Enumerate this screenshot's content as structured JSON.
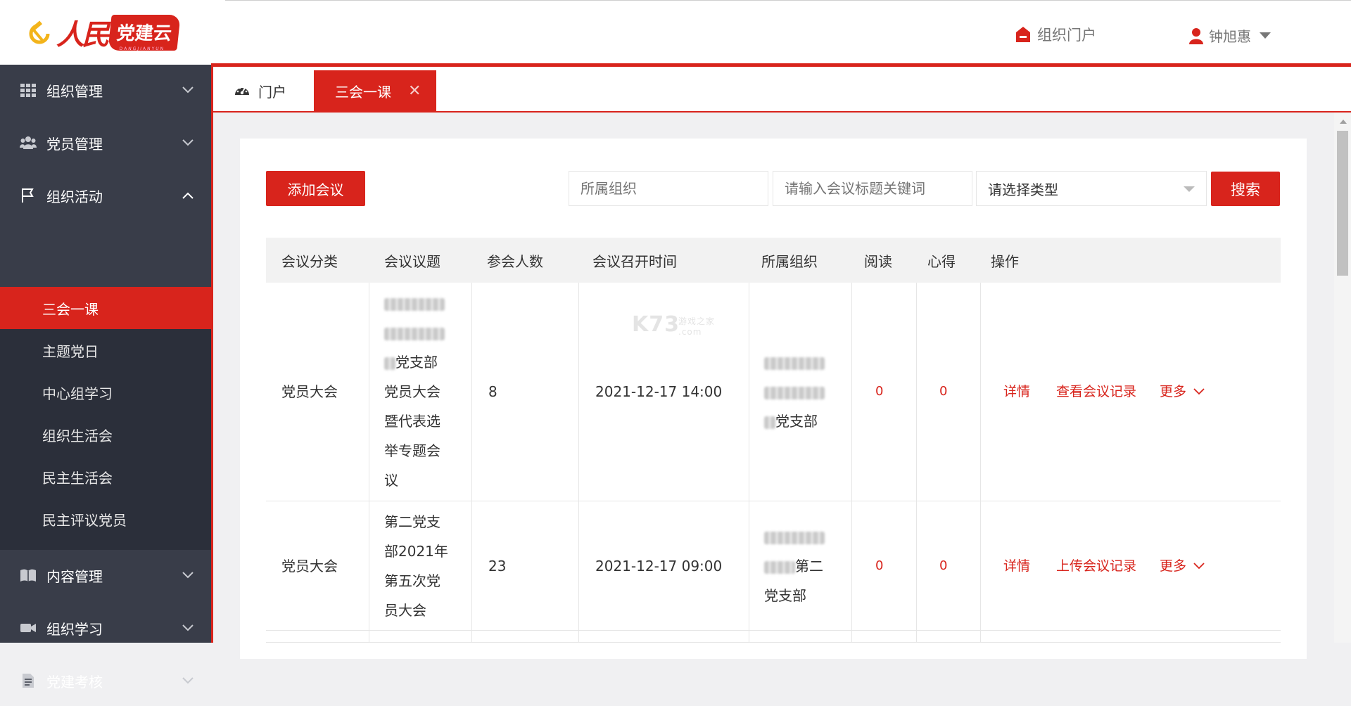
{
  "header": {
    "logo_text": "人民",
    "logo_flag": "党建云",
    "logo_sub": "DANGJIANYUN",
    "portal_link": "组织门户",
    "user_name": "钟旭惠"
  },
  "sidebar": {
    "items": [
      {
        "label": "组织管理",
        "icon": "grid-icon",
        "expanded": false
      },
      {
        "label": "党员管理",
        "icon": "users-icon",
        "expanded": false
      },
      {
        "label": "组织活动",
        "icon": "flag-icon",
        "expanded": true
      },
      {
        "label": "内容管理",
        "icon": "book-icon",
        "expanded": false
      },
      {
        "label": "组织学习",
        "icon": "video-icon",
        "expanded": false
      },
      {
        "label": "党建考核",
        "icon": "document-icon",
        "expanded": false
      }
    ],
    "submenu": [
      {
        "label": "三会一课",
        "active": true
      },
      {
        "label": "主题党日",
        "active": false
      },
      {
        "label": "中心组学习",
        "active": false
      },
      {
        "label": "组织生活会",
        "active": false
      },
      {
        "label": "民主生活会",
        "active": false
      },
      {
        "label": "民主评议党员",
        "active": false
      }
    ]
  },
  "tabs": {
    "portal": "门户",
    "active": "三会一课",
    "close_glyph": "✕"
  },
  "toolbar": {
    "add_button": "添加会议",
    "org_placeholder": "所属组织",
    "keyword_placeholder": "请输入会议标题关键词",
    "type_select": "请选择类型",
    "search_button": "搜索"
  },
  "table": {
    "headers": [
      "会议分类",
      "会议议题",
      "参会人数",
      "会议召开时间",
      "所属组织",
      "阅读",
      "心得",
      "操作"
    ],
    "rows": [
      {
        "category": "党员大会",
        "topic_lines": [
          "党支部",
          "党员大会",
          "暨代表选",
          "举专题会",
          "议"
        ],
        "attendees": "8",
        "time": "2021-12-17 14:00",
        "org_lines": [
          "党支部"
        ],
        "read": "0",
        "notes": "0",
        "action_detail": "详情",
        "action_record": "查看会议记录",
        "action_more": "更多"
      },
      {
        "category": "党员大会",
        "topic_lines": [
          "第二党支",
          "部2021年",
          "第五次党",
          "员大会"
        ],
        "attendees": "23",
        "time": "2021-12-17 09:00",
        "org_lines": [
          "第二",
          "党支部"
        ],
        "read": "0",
        "notes": "0",
        "action_detail": "详情",
        "action_record": "上传会议记录",
        "action_more": "更多"
      }
    ]
  },
  "watermark": {
    "main": "K73",
    "sub": "游戏之家",
    "domain": ".com"
  },
  "colors": {
    "brand_red": "#d8241c",
    "sidebar_bg": "#393d49",
    "submenu_bg": "#2b2f3a"
  }
}
